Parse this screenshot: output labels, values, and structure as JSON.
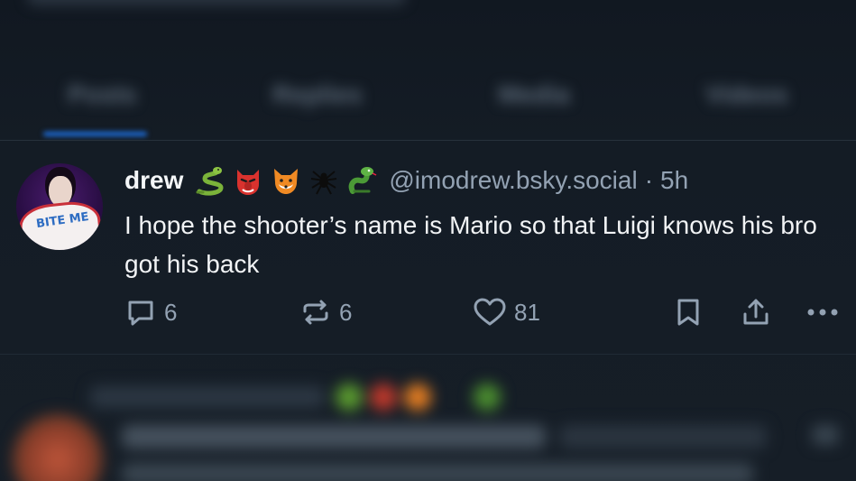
{
  "tabs": [
    {
      "label": "Posts"
    },
    {
      "label": "Replies"
    },
    {
      "label": "Media"
    },
    {
      "label": "Videos"
    }
  ],
  "post": {
    "author_name": "drew",
    "avatar_text": "BITE ME",
    "emojis": [
      "snake-emoji",
      "goblin-emoji",
      "fox-emoji",
      "spider-emoji",
      "serpent-emoji"
    ],
    "handle": "@imodrew.bsky.social",
    "separator": "·",
    "time": "5h",
    "text": "I hope the shooter’s name is Mario so that Luigi knows his bro got his back",
    "actions": {
      "reply_count": "6",
      "repost_count": "6",
      "like_count": "81"
    }
  },
  "colors": {
    "background": "#161e27",
    "muted_text": "#93a2b3",
    "accent": "#1d6fe0"
  }
}
